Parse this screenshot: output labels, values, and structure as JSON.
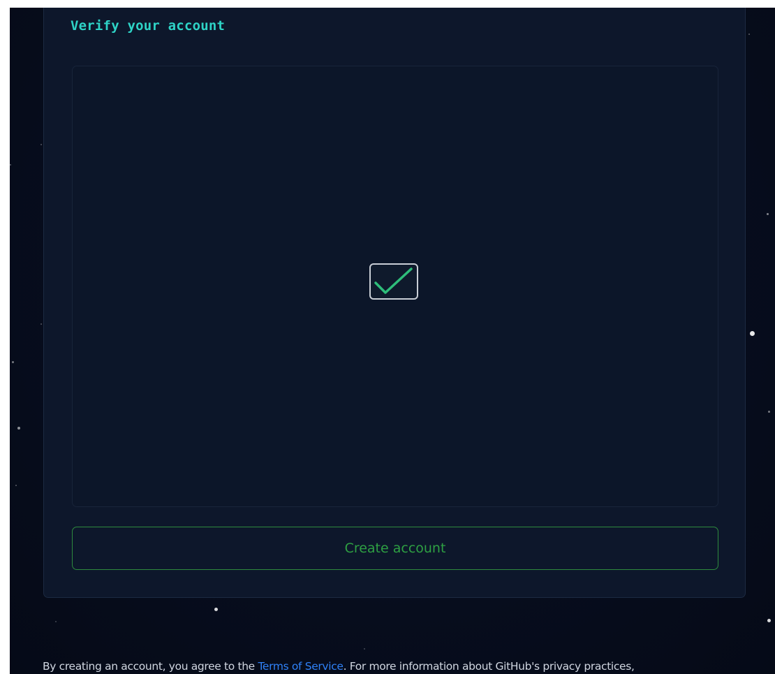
{
  "card": {
    "title": "Verify your account"
  },
  "captcha": {
    "state": "verified",
    "icon": "checkmark-icon"
  },
  "actions": {
    "create_account_label": "Create account"
  },
  "legal": {
    "prefix": "By creating an account, you agree to the ",
    "terms_link": "Terms of Service",
    "suffix": ". For more information about GitHub's privacy practices,"
  },
  "colors": {
    "title": "#2ed3c6",
    "button_text": "#2ea043",
    "button_border": "#2e8b3e",
    "check_stroke": "#2ebd7a",
    "link": "#2f81f7",
    "background": "#070d1d",
    "card": "#0d172b"
  }
}
